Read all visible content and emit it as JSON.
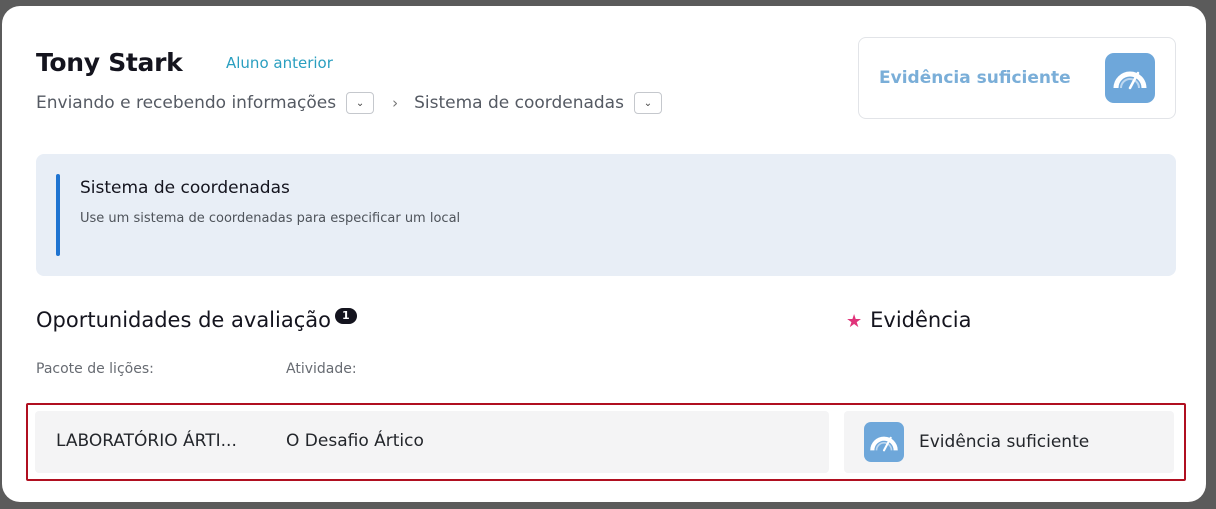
{
  "header": {
    "student_name": "Tony Stark",
    "prev_link": "Aluno anterior",
    "breadcrumb": [
      "Enviando e recebendo informações",
      "Sistema de coordenadas"
    ],
    "evidence_card": {
      "label": "Evidência suficiente",
      "icon": "gauge-icon"
    }
  },
  "banner": {
    "title": "Sistema de coordenadas",
    "description": "Use um sistema de coordenadas para especificar um local"
  },
  "section": {
    "title": "Oportunidades de avaliação",
    "badge": "1",
    "evidence_title": "Evidência",
    "col_package": "Pacote de lições:",
    "col_activity": "Atividade:"
  },
  "row": {
    "package": "LABORATÓRIO ÁRTI...",
    "activity": "O Desafio Ártico",
    "evidence": "Evidência suficiente",
    "evidence_icon": "gauge-icon"
  },
  "colors": {
    "accent_link": "#2a9fc0",
    "gauge": "#6ea7da",
    "banner_bar": "#1f74d1",
    "star": "#e0337a",
    "highlight": "#b00f20"
  }
}
